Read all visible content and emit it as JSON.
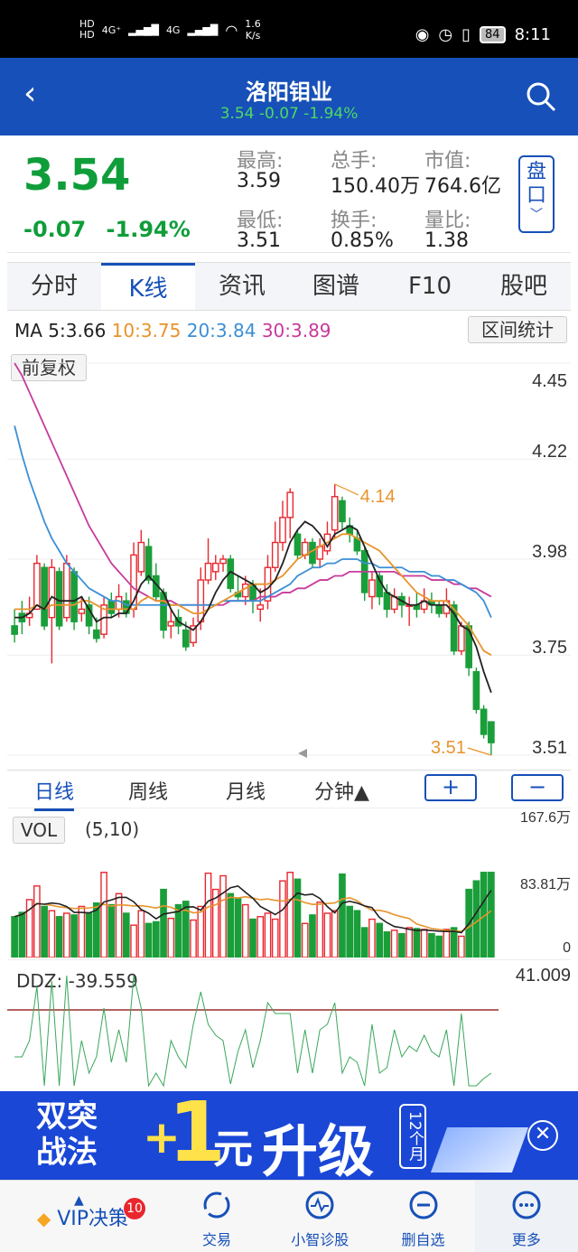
{
  "status_bar": {
    "speed_value": "1.6",
    "speed_unit": "K/s",
    "battery": "84",
    "time": "8:11",
    "sim1": "HD",
    "sim2": "HD",
    "net1": "4G⁺",
    "net2": "4G"
  },
  "header": {
    "title": "洛阳钼业",
    "price": "3.54",
    "change": "-0.07",
    "change_pct": "-1.94%"
  },
  "quote": {
    "price": "3.54",
    "change": "-0.07",
    "change_pct": "-1.94%",
    "high_label": "最高:",
    "high": "3.59",
    "low_label": "最低:",
    "low": "3.51",
    "volume_label": "总手:",
    "volume": "150.40万",
    "turnover_label": "换手:",
    "turnover": "0.85%",
    "mktcap_label": "市值:",
    "mktcap": "764.6亿",
    "ratio_label": "量比:",
    "ratio": "1.38",
    "pankou_1": "盘",
    "pankou_2": "口"
  },
  "tabs": [
    "分时",
    "K线",
    "资讯",
    "图谱",
    "F10",
    "股吧"
  ],
  "active_tab": "K线",
  "colors": {
    "up": "#e8272f",
    "down": "#1a9e3a",
    "ma5": "#222222",
    "ma10": "#e8932b",
    "ma20": "#3b8fd6",
    "ma30": "#c83a9c",
    "brand": "#1750b8"
  },
  "ma_legend": {
    "prefix": "MA",
    "ma5": "5:3.66",
    "ma10": "10:3.75",
    "ma20": "20:3.84",
    "ma30": "30:3.89"
  },
  "range_stats_button": "区间统计",
  "adjust_button": "前复权",
  "price_axis": [
    "4.45",
    "4.22",
    "3.98",
    "3.75",
    "3.51"
  ],
  "annotations": {
    "high": "4.14",
    "low": "3.51"
  },
  "periods": [
    "日线",
    "周线",
    "月线",
    "分钟▲"
  ],
  "zoom_in": "+",
  "zoom_out": "−",
  "vol": {
    "label": "VOL",
    "params": "(5,10)",
    "axis_max": "167.6万",
    "axis_mid": "83.81万",
    "axis_zero": "0"
  },
  "ddz": {
    "label": "DDZ: -39.559",
    "axis_max": "41.009"
  },
  "banner": {
    "t1": "双突",
    "t2": "战法",
    "plus": "+",
    "one": "1",
    "yuan": "元",
    "upgrade": "升级",
    "months": "12个月"
  },
  "bottom_nav": {
    "vip": "VIP决策",
    "vip_badge": "10",
    "trade": "交易",
    "diag": "小智诊股",
    "remove": "删自选",
    "more": "更多"
  },
  "chart_data": {
    "type": "candlestick",
    "ylim": [
      3.51,
      4.45
    ],
    "candles": [
      [
        3.82,
        3.8,
        3.86,
        3.78
      ],
      [
        3.85,
        3.83,
        3.88,
        3.8
      ],
      [
        3.84,
        3.85,
        3.89,
        3.82
      ],
      [
        3.86,
        3.97,
        3.99,
        3.86
      ],
      [
        3.96,
        3.82,
        3.97,
        3.81
      ],
      [
        3.84,
        3.96,
        3.98,
        3.73
      ],
      [
        3.95,
        3.82,
        3.96,
        3.81
      ],
      [
        3.84,
        3.97,
        3.99,
        3.83
      ],
      [
        3.95,
        3.83,
        3.96,
        3.81
      ],
      [
        3.85,
        3.86,
        3.89,
        3.83
      ],
      [
        3.87,
        3.82,
        3.89,
        3.8
      ],
      [
        3.81,
        3.79,
        3.84,
        3.78
      ],
      [
        3.8,
        3.87,
        3.89,
        3.79
      ],
      [
        3.88,
        3.85,
        3.9,
        3.84
      ],
      [
        3.86,
        3.89,
        3.92,
        3.84
      ],
      [
        3.88,
        3.85,
        3.9,
        3.84
      ],
      [
        3.86,
        3.99,
        4.02,
        3.84
      ],
      [
        3.95,
        4.02,
        4.05,
        3.94
      ],
      [
        4.01,
        3.93,
        4.03,
        3.92
      ],
      [
        3.94,
        3.89,
        3.97,
        3.88
      ],
      [
        3.9,
        3.81,
        3.91,
        3.79
      ],
      [
        3.82,
        3.83,
        3.86,
        3.79
      ],
      [
        3.84,
        3.82,
        3.86,
        3.8
      ],
      [
        3.81,
        3.77,
        3.83,
        3.76
      ],
      [
        3.78,
        3.82,
        3.84,
        3.77
      ],
      [
        3.83,
        3.93,
        3.96,
        3.81
      ],
      [
        3.93,
        3.97,
        4.03,
        3.92
      ],
      [
        3.95,
        3.97,
        3.99,
        3.93
      ],
      [
        3.97,
        3.98,
        3.99,
        3.95
      ],
      [
        3.98,
        3.91,
        3.99,
        3.9
      ],
      [
        3.9,
        3.89,
        3.94,
        3.88
      ],
      [
        3.89,
        3.92,
        3.94,
        3.87
      ],
      [
        3.92,
        3.88,
        3.93,
        3.85
      ],
      [
        3.86,
        3.87,
        3.91,
        3.83
      ],
      [
        3.88,
        3.96,
        3.99,
        3.86
      ],
      [
        3.96,
        4.02,
        4.07,
        3.95
      ],
      [
        4.02,
        4.08,
        4.12,
        4.0
      ],
      [
        4.08,
        4.14,
        4.15,
        4.03
      ],
      [
        4.04,
        3.99,
        4.05,
        3.98
      ],
      [
        3.99,
        4.02,
        4.03,
        3.98
      ],
      [
        4.02,
        3.97,
        4.03,
        3.96
      ],
      [
        3.98,
        4.01,
        4.03,
        3.96
      ],
      [
        4.0,
        4.04,
        4.07,
        3.99
      ],
      [
        4.05,
        4.13,
        4.16,
        4.03
      ],
      [
        4.12,
        4.07,
        4.13,
        4.05
      ],
      [
        4.06,
        4.04,
        4.08,
        4.02
      ],
      [
        4.03,
        4.0,
        4.05,
        3.99
      ],
      [
        4.0,
        3.9,
        4.01,
        3.88
      ],
      [
        3.89,
        3.93,
        3.95,
        3.86
      ],
      [
        3.94,
        3.89,
        3.95,
        3.87
      ],
      [
        3.9,
        3.86,
        3.92,
        3.84
      ],
      [
        3.86,
        3.89,
        3.91,
        3.85
      ],
      [
        3.89,
        3.87,
        3.9,
        3.84
      ],
      [
        3.87,
        3.87,
        3.89,
        3.82
      ],
      [
        3.87,
        3.86,
        3.9,
        3.84
      ],
      [
        3.86,
        3.88,
        3.91,
        3.85
      ],
      [
        3.88,
        3.87,
        3.9,
        3.85
      ],
      [
        3.87,
        3.85,
        3.88,
        3.84
      ],
      [
        3.85,
        3.88,
        3.91,
        3.84
      ],
      [
        3.87,
        3.76,
        3.88,
        3.75
      ],
      [
        3.76,
        3.82,
        3.83,
        3.75
      ],
      [
        3.82,
        3.72,
        3.83,
        3.7
      ],
      [
        3.71,
        3.62,
        3.72,
        3.61
      ],
      [
        3.62,
        3.56,
        3.63,
        3.55
      ],
      [
        3.59,
        3.54,
        3.59,
        3.51
      ]
    ],
    "ma5": [
      3.84,
      3.84,
      3.85,
      3.87,
      3.86,
      3.89,
      3.88,
      3.88,
      3.88,
      3.89,
      3.86,
      3.83,
      3.84,
      3.84,
      3.85,
      3.85,
      3.88,
      3.92,
      3.94,
      3.92,
      3.9,
      3.86,
      3.83,
      3.82,
      3.81,
      3.83,
      3.86,
      3.9,
      3.93,
      3.95,
      3.94,
      3.93,
      3.92,
      3.9,
      3.91,
      3.93,
      3.97,
      4.02,
      4.05,
      4.07,
      4.06,
      4.04,
      4.01,
      4.04,
      4.05,
      4.06,
      4.05,
      4.01,
      3.97,
      3.93,
      3.9,
      3.89,
      3.88,
      3.87,
      3.87,
      3.88,
      3.87,
      3.87,
      3.87,
      3.85,
      3.82,
      3.81,
      3.77,
      3.71,
      3.66
    ],
    "ma10": [
      3.86,
      3.86,
      3.86,
      3.87,
      3.86,
      3.87,
      3.87,
      3.87,
      3.87,
      3.88,
      3.88,
      3.87,
      3.86,
      3.86,
      3.86,
      3.86,
      3.86,
      3.88,
      3.89,
      3.88,
      3.88,
      3.87,
      3.87,
      3.86,
      3.85,
      3.85,
      3.86,
      3.87,
      3.88,
      3.89,
      3.9,
      3.91,
      3.92,
      3.92,
      3.92,
      3.93,
      3.94,
      3.96,
      3.98,
      3.99,
      4.0,
      4.01,
      4.02,
      4.03,
      4.04,
      4.04,
      4.03,
      4.02,
      4.01,
      4.0,
      3.98,
      3.96,
      3.94,
      3.92,
      3.9,
      3.89,
      3.88,
      3.88,
      3.88,
      3.86,
      3.84,
      3.82,
      3.79,
      3.76,
      3.75
    ],
    "ma20": [
      4.3,
      4.23,
      4.17,
      4.12,
      4.07,
      4.03,
      4.0,
      3.97,
      3.95,
      3.93,
      3.91,
      3.9,
      3.89,
      3.88,
      3.88,
      3.87,
      3.87,
      3.87,
      3.87,
      3.87,
      3.87,
      3.87,
      3.87,
      3.87,
      3.87,
      3.87,
      3.87,
      3.87,
      3.88,
      3.88,
      3.88,
      3.88,
      3.88,
      3.88,
      3.89,
      3.9,
      3.91,
      3.92,
      3.94,
      3.95,
      3.96,
      3.96,
      3.97,
      3.97,
      3.98,
      3.98,
      3.98,
      3.97,
      3.97,
      3.96,
      3.96,
      3.96,
      3.96,
      3.95,
      3.95,
      3.95,
      3.94,
      3.94,
      3.93,
      3.93,
      3.92,
      3.91,
      3.9,
      3.88,
      3.84
    ],
    "ma30": [
      4.45,
      4.42,
      4.38,
      4.34,
      4.3,
      4.26,
      4.22,
      4.18,
      4.14,
      4.1,
      4.06,
      4.03,
      4.0,
      3.97,
      3.95,
      3.93,
      3.91,
      3.9,
      3.89,
      3.88,
      3.88,
      3.88,
      3.87,
      3.87,
      3.87,
      3.87,
      3.87,
      3.87,
      3.87,
      3.88,
      3.88,
      3.88,
      3.88,
      3.89,
      3.89,
      3.89,
      3.9,
      3.9,
      3.91,
      3.91,
      3.92,
      3.93,
      3.93,
      3.94,
      3.94,
      3.95,
      3.95,
      3.95,
      3.95,
      3.95,
      3.95,
      3.95,
      3.94,
      3.94,
      3.94,
      3.94,
      3.93,
      3.93,
      3.93,
      3.92,
      3.92,
      3.91,
      3.91,
      3.9,
      3.89
    ],
    "volume": [
      48,
      53,
      68,
      84,
      60,
      55,
      48,
      52,
      50,
      60,
      52,
      64,
      100,
      62,
      75,
      52,
      38,
      55,
      40,
      42,
      80,
      46,
      62,
      66,
      44,
      60,
      99,
      80,
      96,
      75,
      70,
      62,
      45,
      48,
      52,
      45,
      90,
      100,
      92,
      40,
      50,
      65,
      52,
      55,
      98,
      60,
      55,
      35,
      45,
      40,
      30,
      32,
      28,
      35,
      34,
      33,
      28,
      25,
      33,
      35,
      25,
      80,
      90,
      100,
      100
    ],
    "vol_ylim": [
      0,
      167.6
    ]
  }
}
